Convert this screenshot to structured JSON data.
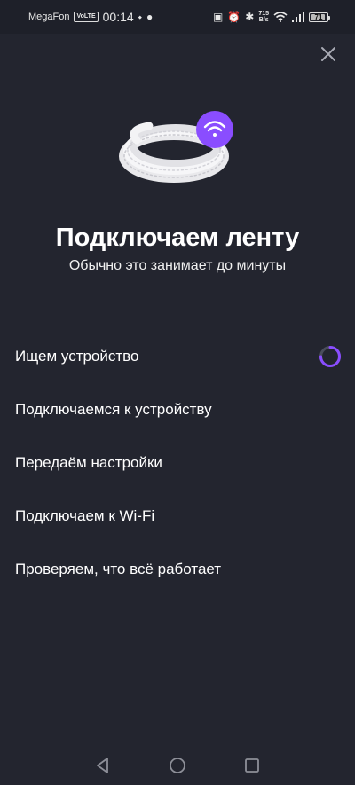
{
  "status_bar": {
    "carrier": "MegaFon",
    "volte": "VoLTE",
    "time": "00:14",
    "speed_value": "715",
    "speed_unit": "B/s",
    "battery": "71"
  },
  "icons": {
    "close": "close-icon",
    "wifi_badge": "wifi-icon",
    "spinner": "loading-spinner-icon"
  },
  "colors": {
    "background": "#23252f",
    "accent": "#8a4dff"
  },
  "title": "Подключаем ленту",
  "subtitle": "Обычно это занимает до минуты",
  "steps": [
    {
      "label": "Ищем устройство",
      "status": "in-progress"
    },
    {
      "label": "Подключаемся к устройству",
      "status": "pending"
    },
    {
      "label": "Передаём настройки",
      "status": "pending"
    },
    {
      "label": "Подключаем к Wi-Fi",
      "status": "pending"
    },
    {
      "label": "Проверяем, что всё работает",
      "status": "pending"
    }
  ],
  "nav": {
    "back": "back-icon",
    "home": "home-icon",
    "recents": "recents-icon"
  }
}
